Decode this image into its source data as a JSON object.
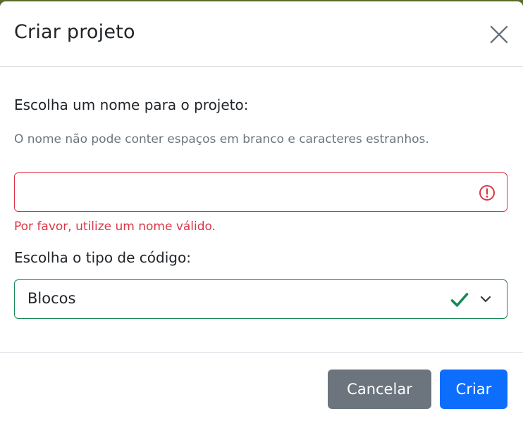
{
  "modal": {
    "title": "Criar projeto"
  },
  "form": {
    "name_label": "Escolha um nome para o projeto:",
    "name_hint": "O nome não pode conter espaços em branco e caracteres estranhos.",
    "name_value": "",
    "name_error": "Por favor, utilize um nome válido.",
    "type_label": "Escolha o tipo de código:",
    "type_selected": "Blocos"
  },
  "footer": {
    "cancel_label": "Cancelar",
    "create_label": "Criar"
  },
  "colors": {
    "error": "#dc3545",
    "valid": "#198754",
    "primary": "#0d6efd",
    "secondary": "#6c757d"
  },
  "icons": {
    "close": "close-icon",
    "error": "exclamation-circle-icon",
    "valid": "checkmark-icon",
    "dropdown": "chevron-down-icon"
  }
}
